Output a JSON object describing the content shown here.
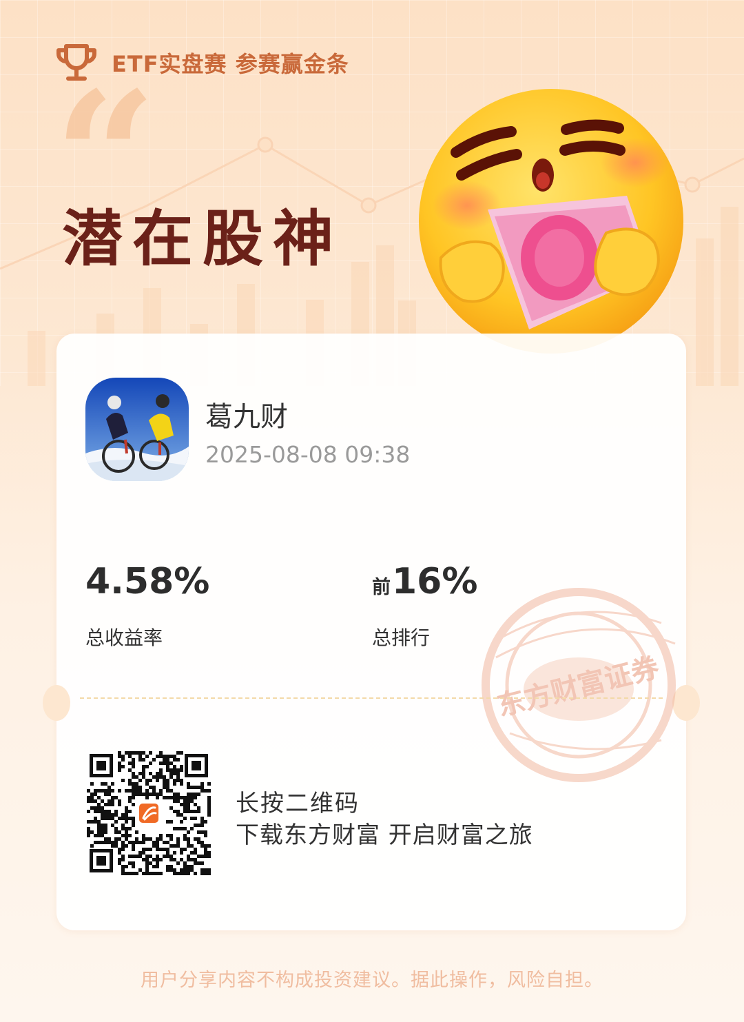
{
  "banner": {
    "text": "ETF实盘赛 参赛赢金条",
    "icon": "trophy-icon"
  },
  "title": "潜在股神",
  "decoration": {
    "emoji": "money-hug-emoji",
    "quote": "“"
  },
  "user": {
    "name": "葛九财",
    "timestamp": "2025-08-08 09:38",
    "avatar": "cyclists-photo"
  },
  "stats": {
    "return_value": "4.58%",
    "return_label": "总收益率",
    "rank_prefix": "前",
    "rank_value": "16%",
    "rank_label": "总排行"
  },
  "stamp": {
    "text": "东方财富证券"
  },
  "qr": {
    "line1": "长按二维码",
    "line2": "下载东方财富 开启财富之旅",
    "logo": "eastmoney-logo-icon"
  },
  "disclaimer": "用户分享内容不构成投资建议。据此操作，风险自担。",
  "colors": {
    "accent": "#c9693a",
    "title": "#6b2119",
    "text": "#333333",
    "muted": "#9a9a9a",
    "logo": "#f06a26"
  }
}
